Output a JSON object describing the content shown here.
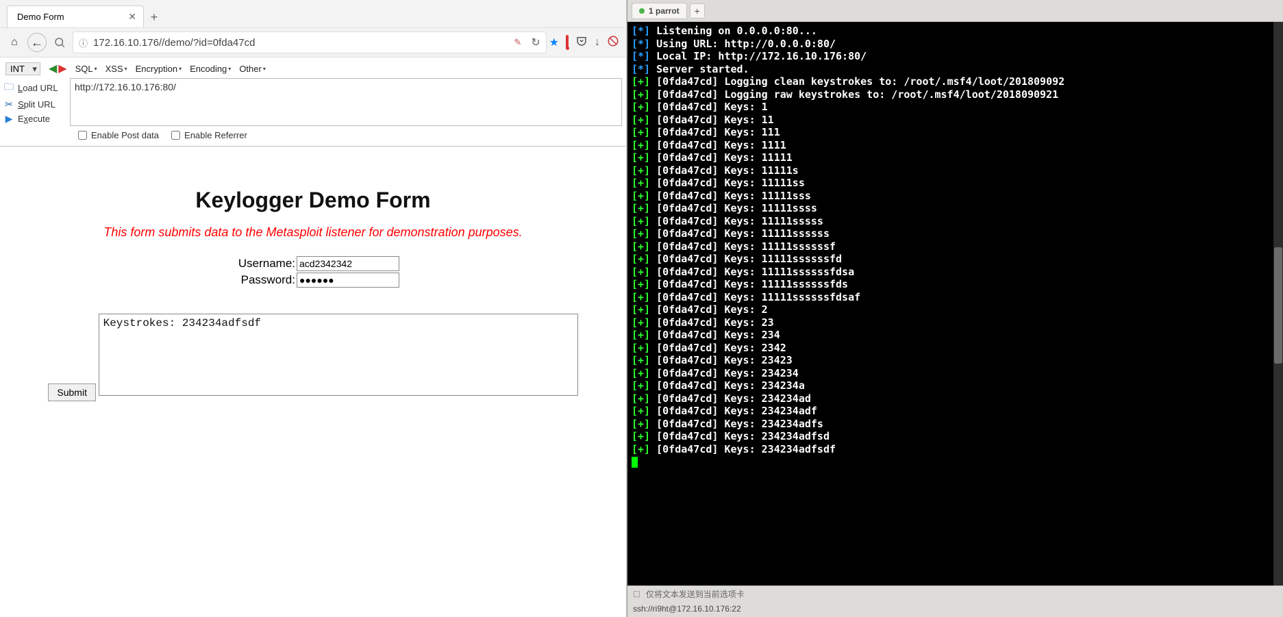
{
  "browser": {
    "tab_title": "Demo Form",
    "new_tab_glyph": "+",
    "home_icon": "⌂",
    "back_icon": "←",
    "info_icon": "ⓘ",
    "url": "172.16.10.176//demo/?id=0fda47cd",
    "feather_color": "#cc5555",
    "reload_icon": "↻",
    "star_icon": "★",
    "pocket_icon": "⌄",
    "download_icon": "↓"
  },
  "hackbar": {
    "select_label": "INT",
    "menus": [
      "SQL",
      "XSS",
      "Encryption",
      "Encoding",
      "Other"
    ],
    "sidebar": {
      "load": "Load URL",
      "split": "Split URL",
      "execute": "Execute"
    },
    "load_underline_char": "L",
    "split_underline_char": "S",
    "exec_underline_char": "x",
    "url_text": "http://172.16.10.176:80/",
    "enable_post": "Enable Post data",
    "enable_referrer": "Enable Referrer"
  },
  "page": {
    "heading": "Keylogger Demo Form",
    "note": "This form submits data to the Metasploit listener for demonstration purposes.",
    "username_label": "Username:",
    "username_value": "acd2342342",
    "password_label": "Password:",
    "password_value": "●●●●●●",
    "submit_label": "Submit",
    "keystrokes_text": "Keystrokes: 234234adfsdf"
  },
  "terminal": {
    "tab_label": "1 parrot",
    "lines": [
      {
        "sym": "[*]",
        "color": "#2aa0ff",
        "text": " Listening on 0.0.0.0:80..."
      },
      {
        "sym": "[*]",
        "color": "#2aa0ff",
        "text": " Using URL: http://0.0.0.0:80/"
      },
      {
        "sym": "[*]",
        "color": "#2aa0ff",
        "text": " Local IP: http://172.16.10.176:80/"
      },
      {
        "sym": "[*]",
        "color": "#2aa0ff",
        "text": " Server started."
      },
      {
        "sym": "[+]",
        "color": "#2dff2d",
        "text": " [0fda47cd] Logging clean keystrokes to: /root/.msf4/loot/201809092"
      },
      {
        "sym": "[+]",
        "color": "#2dff2d",
        "text": " [0fda47cd] Logging raw keystrokes to: /root/.msf4/loot/2018090921"
      },
      {
        "sym": "[+]",
        "color": "#2dff2d",
        "text": " [0fda47cd] Keys: 1"
      },
      {
        "sym": "[+]",
        "color": "#2dff2d",
        "text": " [0fda47cd] Keys: 11"
      },
      {
        "sym": "[+]",
        "color": "#2dff2d",
        "text": " [0fda47cd] Keys: 111"
      },
      {
        "sym": "[+]",
        "color": "#2dff2d",
        "text": " [0fda47cd] Keys: 1111"
      },
      {
        "sym": "[+]",
        "color": "#2dff2d",
        "text": " [0fda47cd] Keys: 11111"
      },
      {
        "sym": "[+]",
        "color": "#2dff2d",
        "text": " [0fda47cd] Keys: 11111s"
      },
      {
        "sym": "[+]",
        "color": "#2dff2d",
        "text": " [0fda47cd] Keys: 11111ss"
      },
      {
        "sym": "[+]",
        "color": "#2dff2d",
        "text": " [0fda47cd] Keys: 11111sss"
      },
      {
        "sym": "[+]",
        "color": "#2dff2d",
        "text": " [0fda47cd] Keys: 11111ssss"
      },
      {
        "sym": "[+]",
        "color": "#2dff2d",
        "text": " [0fda47cd] Keys: 11111sssss"
      },
      {
        "sym": "[+]",
        "color": "#2dff2d",
        "text": " [0fda47cd] Keys: 11111ssssss"
      },
      {
        "sym": "[+]",
        "color": "#2dff2d",
        "text": " [0fda47cd] Keys: 11111ssssssf"
      },
      {
        "sym": "[+]",
        "color": "#2dff2d",
        "text": " [0fda47cd] Keys: 11111ssssssfd"
      },
      {
        "sym": "[+]",
        "color": "#2dff2d",
        "text": " [0fda47cd] Keys: 11111ssssssfdsa"
      },
      {
        "sym": "[+]",
        "color": "#2dff2d",
        "text": " [0fda47cd] Keys: 11111ssssssfds"
      },
      {
        "sym": "[+]",
        "color": "#2dff2d",
        "text": " [0fda47cd] Keys: 11111ssssssfdsaf"
      },
      {
        "sym": "[+]",
        "color": "#2dff2d",
        "text": " [0fda47cd] Keys: 2"
      },
      {
        "sym": "[+]",
        "color": "#2dff2d",
        "text": " [0fda47cd] Keys: 23"
      },
      {
        "sym": "[+]",
        "color": "#2dff2d",
        "text": " [0fda47cd] Keys: 234"
      },
      {
        "sym": "[+]",
        "color": "#2dff2d",
        "text": " [0fda47cd] Keys: 2342"
      },
      {
        "sym": "[+]",
        "color": "#2dff2d",
        "text": " [0fda47cd] Keys: 23423"
      },
      {
        "sym": "[+]",
        "color": "#2dff2d",
        "text": " [0fda47cd] Keys: 234234"
      },
      {
        "sym": "[+]",
        "color": "#2dff2d",
        "text": " [0fda47cd] Keys: 234234a"
      },
      {
        "sym": "[+]",
        "color": "#2dff2d",
        "text": " [0fda47cd] Keys: 234234ad"
      },
      {
        "sym": "[+]",
        "color": "#2dff2d",
        "text": " [0fda47cd] Keys: 234234adf"
      },
      {
        "sym": "[+]",
        "color": "#2dff2d",
        "text": " [0fda47cd] Keys: 234234adfs"
      },
      {
        "sym": "[+]",
        "color": "#2dff2d",
        "text": " [0fda47cd] Keys: 234234adfsd"
      },
      {
        "sym": "[+]",
        "color": "#2dff2d",
        "text": " [0fda47cd] Keys: 234234adfsdf"
      }
    ],
    "footer_checkbox_label": "仅将文本发送到当前选项卡",
    "ssh_status": "ssh://ri9ht@172.16.10.176:22"
  }
}
